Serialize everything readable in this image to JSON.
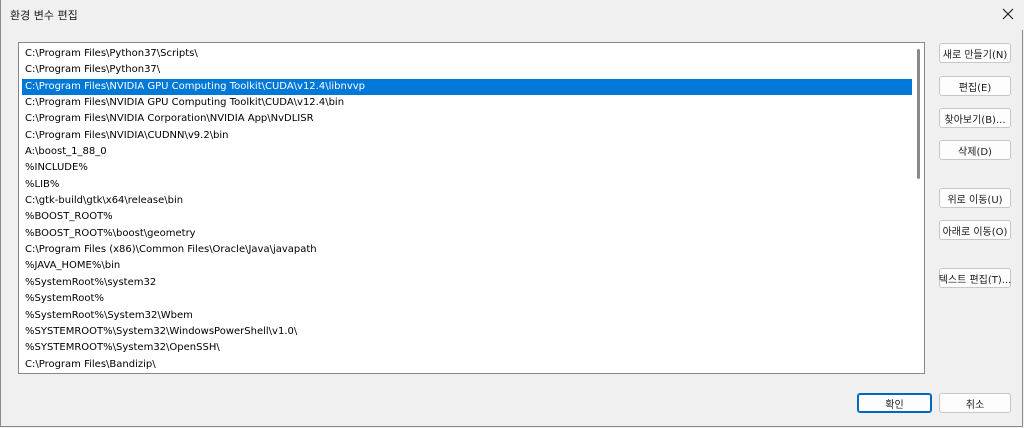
{
  "window": {
    "title": "환경 변수 편집"
  },
  "list": {
    "items": [
      "C:\\Program Files\\Python37\\Scripts\\",
      "C:\\Program Files\\Python37\\",
      "C:\\Program Files\\NVIDIA GPU Computing Toolkit\\CUDA\\v12.4\\libnvvp",
      "C:\\Program Files\\NVIDIA GPU Computing Toolkit\\CUDA\\v12.4\\bin",
      "C:\\Program Files\\NVIDIA Corporation\\NVIDIA App\\NvDLISR",
      "C:\\Program Files\\NVIDIA\\CUDNN\\v9.2\\bin",
      "A:\\boost_1_88_0",
      "%INCLUDE%",
      "%LIB%",
      "C:\\gtk-build\\gtk\\x64\\release\\bin",
      "%BOOST_ROOT%",
      "%BOOST_ROOT%\\boost\\geometry",
      "C:\\Program Files (x86)\\Common Files\\Oracle\\Java\\javapath",
      "%JAVA_HOME%\\bin",
      "%SystemRoot%\\system32",
      "%SystemRoot%",
      "%SystemRoot%\\System32\\Wbem",
      "%SYSTEMROOT%\\System32\\WindowsPowerShell\\v1.0\\",
      "%SYSTEMROOT%\\System32\\OpenSSH\\",
      "C:\\Program Files\\Bandizip\\"
    ],
    "selected_index": 2
  },
  "buttons": {
    "new": "새로 만들기(N)",
    "edit": "편집(E)",
    "browse": "찾아보기(B)...",
    "delete": "삭제(D)",
    "move_up": "위로 이동(U)",
    "move_down": "아래로 이동(O)",
    "edit_text": "텍스트 편집(T)...",
    "ok": "확인",
    "cancel": "취소"
  },
  "icons": {
    "close": "close-icon"
  },
  "colors": {
    "selection": "#0078d7",
    "primary_border": "#0067c0"
  }
}
